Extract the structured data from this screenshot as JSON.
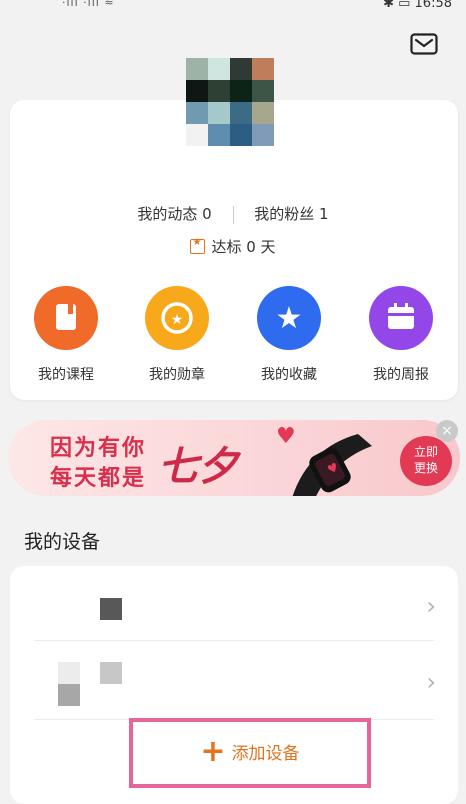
{
  "status_bar": {
    "signal": "·ıll ·ıll ≈",
    "time": "16:58",
    "battery": "79"
  },
  "profile": {
    "stats": {
      "posts": "我的动态 0",
      "fans": "我的粉丝 1"
    },
    "goal": "达标 0 天"
  },
  "quick_actions": [
    {
      "label": "我的课程",
      "color": "#f06a2a",
      "icon": "course-book-icon"
    },
    {
      "label": "我的勋章",
      "color": "#f7a81b",
      "icon": "medal-icon"
    },
    {
      "label": "我的收藏",
      "color": "#2f6bef",
      "icon": "star-icon"
    },
    {
      "label": "我的周报",
      "color": "#9347e8",
      "icon": "weekly-report-icon"
    }
  ],
  "banner": {
    "line1": "因为有你",
    "line2": "每天都是",
    "big": "七夕",
    "cta": "立即\n更换"
  },
  "devices": {
    "title": "我的设备"
  },
  "add_device": {
    "label": "添加设备"
  },
  "colors": {
    "accent": "#e2731f",
    "highlight": "#e5679a"
  }
}
